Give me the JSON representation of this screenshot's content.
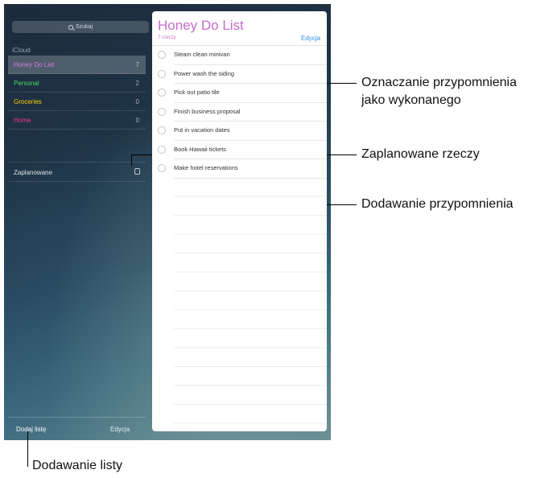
{
  "sidebar": {
    "search_placeholder": "Szukaj",
    "section_header": "iCloud",
    "lists": [
      {
        "label": "Honey Do List",
        "count": "7",
        "color": "#d37ee0",
        "selected": true
      },
      {
        "label": "Personal",
        "count": "2",
        "color": "#4cd964"
      },
      {
        "label": "Groceries",
        "count": "0",
        "color": "#ffcc00"
      },
      {
        "label": "Home",
        "count": "0",
        "color": "#ff2d8a"
      }
    ],
    "scheduled_label": "Zaplanowane",
    "add_list_label": "Dodaj listę",
    "edit_label": "Edycja"
  },
  "list": {
    "title": "Honey Do List",
    "item_count": "7 rzeczy",
    "edit_label": "Edycja",
    "accent_color": "#c76ccc",
    "reminders": [
      "Steam clean minivan",
      "Power wash the siding",
      "Pick out patio tile",
      "Finish business proposal",
      "Put in vacation dates",
      "Book Hawaii tickets",
      "Make hotel reservations"
    ]
  },
  "callouts": {
    "mark_complete_line1": "Oznaczanie przypomnienia",
    "mark_complete_line2": "jako wykonanego",
    "scheduled": "Zaplanowane rzeczy",
    "add_reminder": "Dodawanie przypomnienia",
    "add_list": "Dodawanie listy"
  }
}
